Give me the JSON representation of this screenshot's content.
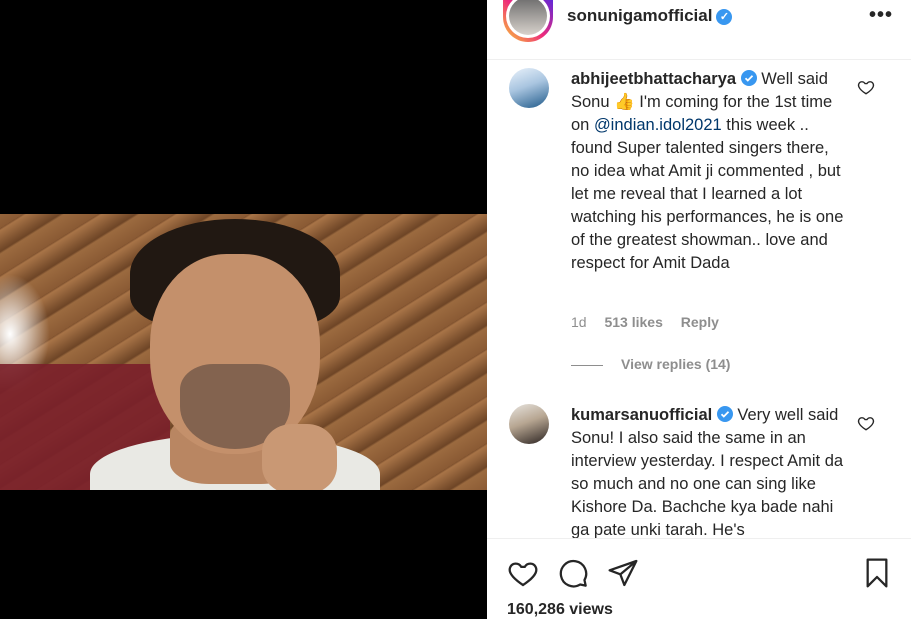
{
  "post": {
    "username": "sonunigamofficial",
    "verified_icon": "verified-badge-icon",
    "more_label": "•••"
  },
  "comments": [
    {
      "author": "abhijeetbhattacharya",
      "text_before": "Well said Sonu 👍 I'm coming for the 1st time on ",
      "mention": "@indian.idol2021",
      "text_after": " this week .. found Super talented singers there, no idea what Amit ji commented , but let me reveal that I learned a lot watching his performances, he is one of the greatest showman.. love and respect for Amit Dada",
      "time": "1d",
      "likes": "513 likes",
      "reply_label": "Reply",
      "view_replies": "View replies (14)"
    },
    {
      "author": "kumarsanuofficial",
      "text": "Very well said Sonu! I also said the same in an interview yesterday. I respect Amit da so much and no one can sing like Kishore Da. Bachche kya bade nahi ga pate unki tarah. He's"
    }
  ],
  "footer": {
    "views": "160,286 views"
  },
  "colors": {
    "verified": "#3897f0",
    "mention": "#00376b",
    "meta": "#8e8e8e"
  }
}
